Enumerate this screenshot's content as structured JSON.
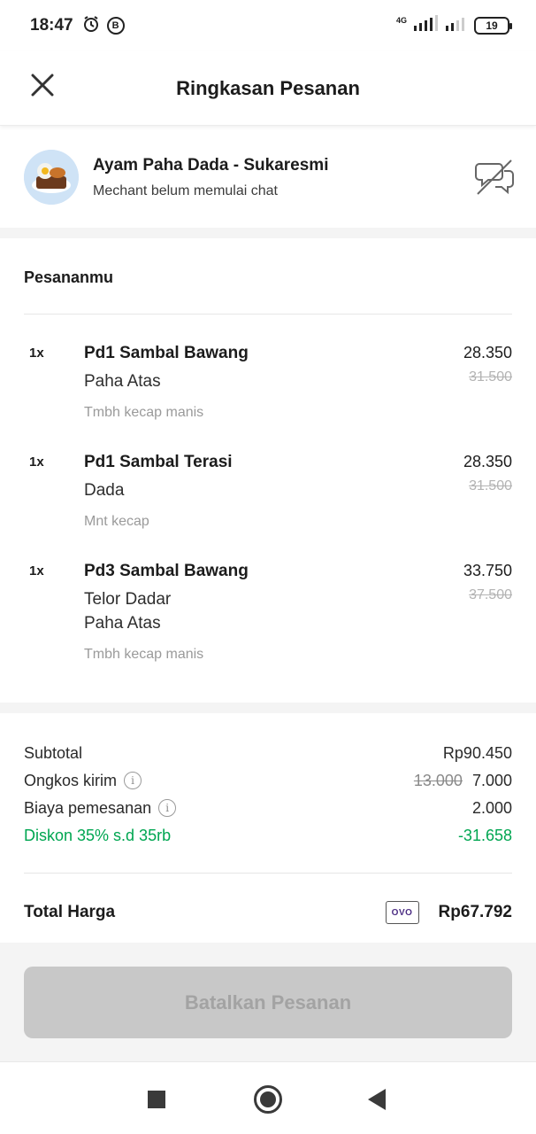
{
  "status_bar": {
    "time": "18:47",
    "alarm_icon": "alarm-clock-icon",
    "b_icon": "B",
    "network": "4G",
    "battery": "19"
  },
  "header": {
    "title": "Ringkasan Pesanan",
    "close_icon": "close-icon"
  },
  "merchant": {
    "name": "Ayam Paha Dada - Sukaresmi",
    "status": "Mechant belum memulai chat",
    "chat_icon": "chat-disabled-icon"
  },
  "orders": {
    "title": "Pesananmu",
    "items": [
      {
        "qty": "1x",
        "name": "Pd1 Sambal Bawang",
        "variants": [
          "Paha Atas"
        ],
        "note": "Tmbh kecap manis",
        "price": "28.350",
        "old_price": "31.500"
      },
      {
        "qty": "1x",
        "name": "Pd1 Sambal Terasi",
        "variants": [
          "Dada"
        ],
        "note": "Mnt kecap",
        "price": "28.350",
        "old_price": "31.500"
      },
      {
        "qty": "1x",
        "name": "Pd3 Sambal Bawang",
        "variants": [
          "Telor Dadar",
          "Paha Atas"
        ],
        "note": "Tmbh kecap manis",
        "price": "33.750",
        "old_price": "37.500"
      }
    ]
  },
  "summary": {
    "subtotal_label": "Subtotal",
    "subtotal_value": "Rp90.450",
    "delivery_label": "Ongkos kirim",
    "delivery_old": "13.000",
    "delivery_value": "7.000",
    "fee_label": "Biaya pemesanan",
    "fee_value": "2.000",
    "discount_label": "Diskon 35% s.d 35rb",
    "discount_value": "-31.658",
    "discount_color": "#00a651",
    "total_label": "Total Harga",
    "payment_badge": "OVO",
    "total_value": "Rp67.792"
  },
  "actions": {
    "cancel_label": "Batalkan Pesanan"
  },
  "nav": {
    "recents_icon": "square-icon",
    "home_icon": "home-circle-icon",
    "back_icon": "back-triangle-icon"
  }
}
